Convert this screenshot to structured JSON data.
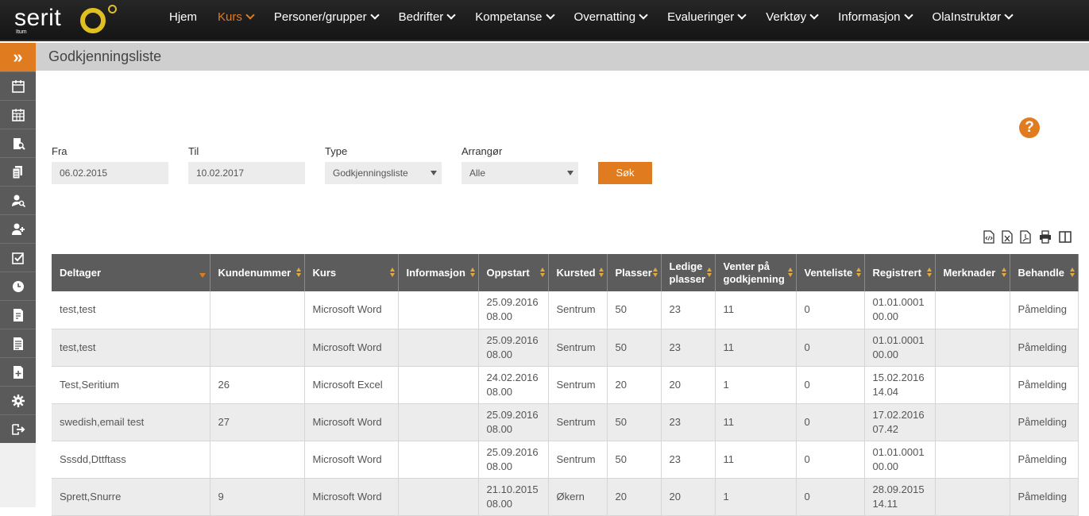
{
  "logo": {
    "text": "serit",
    "sub": "Itum"
  },
  "nav": [
    {
      "label": "Hjem",
      "chevron": false,
      "active": false
    },
    {
      "label": "Kurs",
      "chevron": true,
      "active": true
    },
    {
      "label": "Personer/grupper",
      "chevron": true,
      "active": false
    },
    {
      "label": "Bedrifter",
      "chevron": true,
      "active": false
    },
    {
      "label": "Kompetanse",
      "chevron": true,
      "active": false
    },
    {
      "label": "Overnatting",
      "chevron": true,
      "active": false
    },
    {
      "label": "Evalueringer",
      "chevron": true,
      "active": false
    },
    {
      "label": "Verktøy",
      "chevron": true,
      "active": false
    },
    {
      "label": "Informasjon",
      "chevron": true,
      "active": false
    },
    {
      "label": "OlaInstruktør",
      "chevron": true,
      "active": false
    }
  ],
  "colors": {
    "accent": "#e07b1f",
    "nav_bg": "#1f1f1f",
    "sidebar_item": "#5a5a5a",
    "header_bg": "#cfcfcf",
    "logo_ring": "#e0c020"
  },
  "sidebar": {
    "toggle_icon": "double-chevron-right-icon",
    "items": [
      "calendar-icon",
      "calendar-grid-icon",
      "search-document-icon",
      "documents-icon",
      "user-search-icon",
      "user-add-icon",
      "checkbox-icon",
      "clock-icon",
      "report-icon",
      "report-list-icon",
      "report-add-icon",
      "gear-icon",
      "logout-icon"
    ]
  },
  "page": {
    "title": "Godkjenningsliste",
    "help_label": "?"
  },
  "filters": {
    "fra_label": "Fra",
    "fra_value": "06.02.2015",
    "til_label": "Til",
    "til_value": "10.02.2017",
    "type_label": "Type",
    "type_value": "Godkjenningsliste",
    "arrangor_label": "Arrangør",
    "arrangor_value": "Alle",
    "search_label": "Søk"
  },
  "export_icons": [
    "xml-export-icon",
    "excel-export-icon",
    "pdf-export-icon",
    "print-icon",
    "columns-icon"
  ],
  "table": {
    "headers": [
      "Deltager",
      "Kundenummer",
      "Kurs",
      "Informasjon",
      "Oppstart",
      "Kursted",
      "Plasser",
      "Ledige plasser",
      "Venter på godkjenning",
      "Venteliste",
      "Registrert",
      "Merknader",
      "Behandle"
    ],
    "rows": [
      [
        "test,test",
        "",
        "Microsoft Word",
        "",
        "25.09.2016 08.00",
        "Sentrum",
        "50",
        "23",
        "11",
        "0",
        "01.01.0001 00.00",
        "",
        "Påmelding"
      ],
      [
        "test,test",
        "",
        "Microsoft Word",
        "",
        "25.09.2016 08.00",
        "Sentrum",
        "50",
        "23",
        "11",
        "0",
        "01.01.0001 00.00",
        "",
        "Påmelding"
      ],
      [
        "Test,Seritium",
        "26",
        "Microsoft Excel",
        "",
        "24.02.2016 08.00",
        "Sentrum",
        "20",
        "20",
        "1",
        "0",
        "15.02.2016 14.04",
        "",
        "Påmelding"
      ],
      [
        "swedish,email test",
        "27",
        "Microsoft Word",
        "",
        "25.09.2016 08.00",
        "Sentrum",
        "50",
        "23",
        "11",
        "0",
        "17.02.2016 07.42",
        "",
        "Påmelding"
      ],
      [
        "Sssdd,Dttftass",
        "",
        "Microsoft Word",
        "",
        "25.09.2016 08.00",
        "Sentrum",
        "50",
        "23",
        "11",
        "0",
        "01.01.0001 00.00",
        "",
        "Påmelding"
      ],
      [
        "Sprett,Snurre",
        "9",
        "Microsoft Word",
        "",
        "21.10.2015 08.00",
        "Økern",
        "20",
        "20",
        "1",
        "0",
        "28.09.2015 14.11",
        "",
        "Påmelding"
      ]
    ]
  }
}
